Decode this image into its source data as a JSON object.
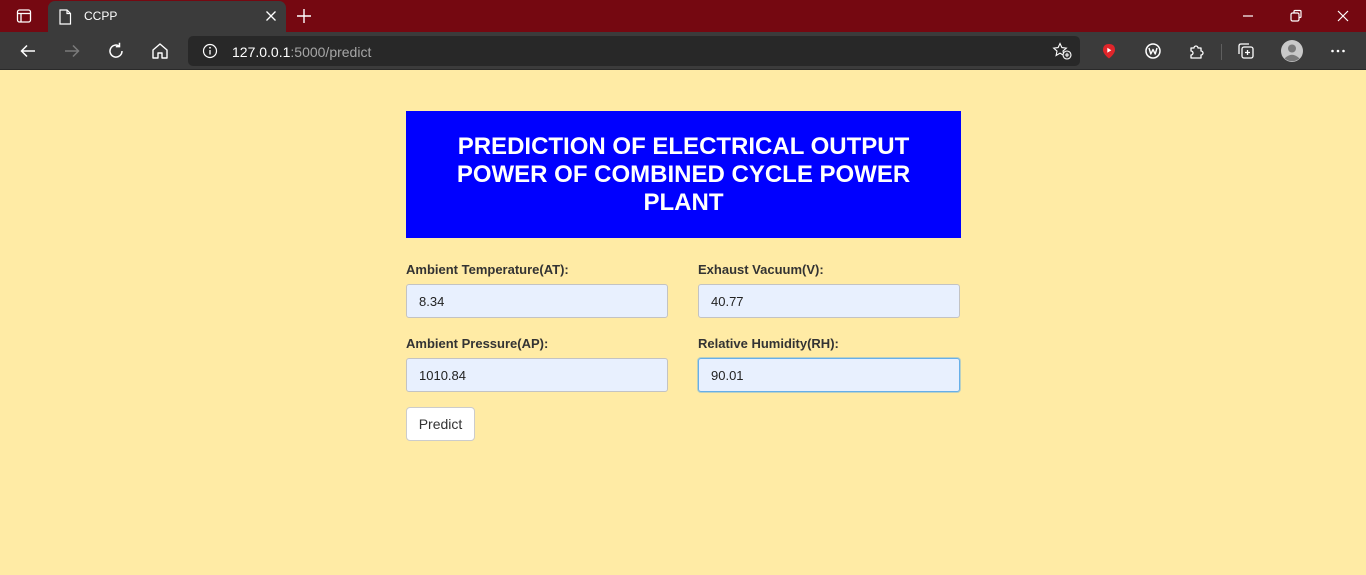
{
  "browser": {
    "tab": {
      "title": "CCPP"
    },
    "address_bar": {
      "host": "127.0.0.1",
      "path": ":5000/predict"
    }
  },
  "page": {
    "header": {
      "title": "PREDICTION OF ELECTRICAL OUTPUT POWER OF COMBINED CYCLE POWER PLANT"
    },
    "form": {
      "fields": [
        {
          "label": "Ambient Temperature(AT):",
          "value": "8.34"
        },
        {
          "label": "Exhaust Vacuum(V):",
          "value": "40.77"
        },
        {
          "label": "Ambient Pressure(AP):",
          "value": "1010.84"
        },
        {
          "label": "Relative Humidity(RH):",
          "value": "90.01"
        }
      ],
      "submit_label": "Predict"
    }
  },
  "colors": {
    "page_background": "#ffeba5",
    "header_background": "#0000ff",
    "tabbar_background": "#750811",
    "input_background": "#e8f0fe"
  }
}
